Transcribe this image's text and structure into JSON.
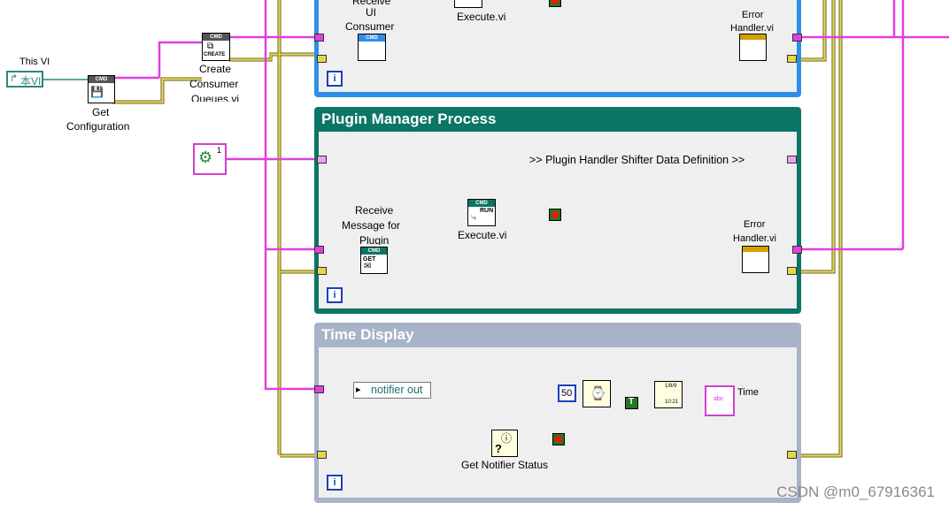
{
  "left": {
    "this_vi_label": "This VI",
    "this_vi_text": "本VI",
    "get_config_label_1": "Get",
    "get_config_label_2": "Configuration",
    "create_queues_label_1": "Create",
    "create_queues_label_2": "Consumer",
    "create_queues_label_3": "Queues.vi",
    "cmd_text": "CMD",
    "create_text": "CREATE",
    "constant_value": "1"
  },
  "ui_loop": {
    "receive_label_1": "Receive",
    "receive_label_2": "UI",
    "receive_label_3": "Consumer",
    "execute_label": "Execute.vi",
    "error_label_1": "Error",
    "error_label_2": "Handler.vi",
    "iteration_symbol": "i"
  },
  "plugin_loop": {
    "title": "Plugin Manager Process",
    "shifter_text": ">> Plugin Handler Shifter Data Definition >>",
    "receive_label_1": "Receive",
    "receive_label_2": "Message for",
    "receive_label_3": "Plugin",
    "execute_label": "Execute.vi",
    "error_label_1": "Error",
    "error_label_2": "Handler.vi",
    "run_text": "RUN",
    "get_text": "GET",
    "iteration_symbol": "i"
  },
  "time_loop": {
    "title": "Time Display",
    "notifier_text": "notifier out",
    "wait_value": "50",
    "bool_text": "T",
    "format_line_1": "1/8/9",
    "format_line_2": "10:21",
    "time_label": "Time",
    "notifier_status_label": "Get Notifier Status",
    "abc_text": "abc",
    "iteration_symbol": "i"
  },
  "watermark": "CSDN @m0_67916361",
  "colors": {
    "ui_loop_border": "#2f8fe8",
    "plugin_loop_border": "#0b7566",
    "time_loop_border": "#a8b2c8",
    "wire_pink": "#e040e0",
    "wire_error": "#c8b400",
    "wire_teal": "#2a8a7a"
  }
}
